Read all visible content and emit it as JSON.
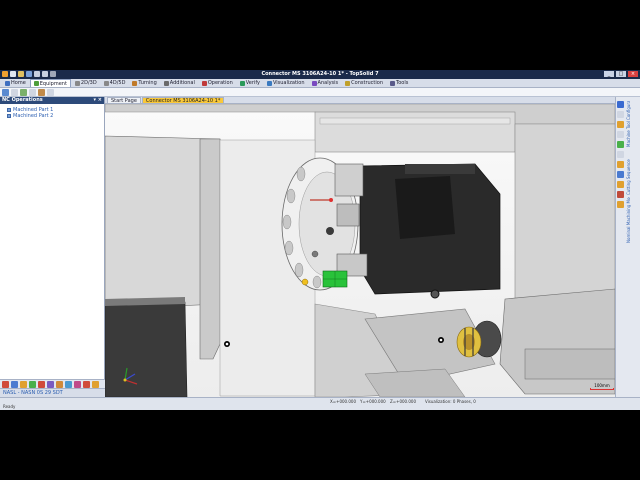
{
  "window": {
    "title": "Connector MS 3106A24-10 1* - TopSolid 7"
  },
  "ribbon_tabs": [
    {
      "label": "Home",
      "color": "#3f6fc0"
    },
    {
      "label": "Equipment",
      "color": "#4e9e3a",
      "active": true
    },
    {
      "label": "2D/3D",
      "color": "#888888"
    },
    {
      "label": "4D/5D",
      "color": "#888888"
    },
    {
      "label": "Turning",
      "color": "#c07a2a"
    },
    {
      "label": "Additional",
      "color": "#6a6a6a"
    },
    {
      "label": "Operation",
      "color": "#c03a3a"
    },
    {
      "label": "Verify",
      "color": "#2a9a5a"
    },
    {
      "label": "Visualization",
      "color": "#3a7ac0"
    },
    {
      "label": "Analysis",
      "color": "#7a4ac0"
    },
    {
      "label": "Construction",
      "color": "#c0a02a"
    },
    {
      "label": "Tools",
      "color": "#5a5a8a"
    }
  ],
  "left_panel": {
    "header": "NC Operations",
    "tree": [
      {
        "label": "Machined Part 1"
      },
      {
        "label": "Machined Part 2"
      }
    ],
    "footer": "NASL - NASN 0S 29 SDT"
  },
  "doc_tabs": [
    {
      "label": "Start Page"
    },
    {
      "label": "Connector MS 3106A24-10 1*",
      "active": true
    }
  ],
  "right_bar": {
    "labels": [
      "Machine Tool Configuration",
      "Cutting Sequence",
      "Nominal Machining Model"
    ]
  },
  "statusbar": {
    "ready": "Ready",
    "x": "X=+000.000",
    "y": "Y=+000.000",
    "z": "Z=+000.000",
    "visualization": "Visualization: 0 Phases, 0"
  },
  "scale": {
    "label": "100mm"
  },
  "colors": {
    "title_bar": "#1a2a4a",
    "panel_header": "#2d4a7a",
    "active_doc_tab": "#f9c83a",
    "green_part": "#29c23a",
    "machine_grey": "#d8d8d8"
  }
}
